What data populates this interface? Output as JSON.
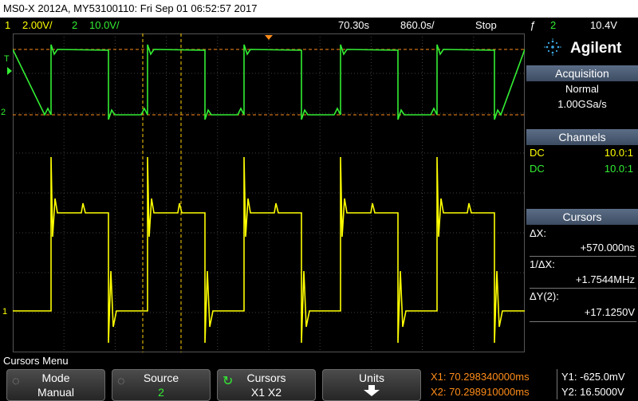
{
  "title": "MS0-X 2012A, MY53100110: Fri Sep 01 06:52:57 2017",
  "status": {
    "ch1_num": "1",
    "ch1_scale": "2.00V/",
    "ch2_num": "2",
    "ch2_scale": "10.0V/",
    "time_delay": "70.30s",
    "time_scale": "860.0s/",
    "run_state": "Stop",
    "trigger_icon": "trigger-edge-icon",
    "trigger_glyph": "ƒ",
    "trigger_source": "2",
    "trigger_level": "10.4V"
  },
  "brand": {
    "name": "Agilent"
  },
  "acquisition": {
    "header": "Acquisition",
    "mode": "Normal",
    "rate": "1.00GSa/s"
  },
  "channels": {
    "header": "Channels",
    "rows": [
      {
        "coupling": "DC",
        "probe": "10.0:1",
        "color": "#ffff00"
      },
      {
        "coupling": "DC",
        "probe": "10.0:1",
        "color": "#33ee33"
      }
    ]
  },
  "cursors_panel": {
    "header": "Cursors",
    "dx_label": "ΔX:",
    "dx_value": "+570.000ns",
    "inv_dx_label": "1/ΔX:",
    "inv_dx_value": "+1.7544MHz",
    "dy_label": "ΔY(2):",
    "dy_value": "+17.1250V"
  },
  "markers": {
    "trigger": "T",
    "ch2": "2",
    "ch1": "1"
  },
  "menu": {
    "title": "Cursors Menu",
    "softkeys": [
      {
        "line1": "Mode",
        "line2": "Manual"
      },
      {
        "line1": "Source",
        "line2": "2"
      },
      {
        "line1": "Cursors",
        "line2": "X1 X2",
        "icon": "knob-icon"
      },
      {
        "line1": "Units",
        "line2": "",
        "icon": "down-arrow-icon"
      }
    ]
  },
  "readout": {
    "x1": "X1: 70.298340000ms",
    "x2": "X2: 70.298910000ms",
    "y1": "Y1: -625.0mV",
    "y2": "Y2: 16.5000V"
  },
  "colors": {
    "ch1": "#ffff00",
    "ch2": "#33ee33",
    "cursor": "#ff8c1a",
    "x_cursor": "#ffd200",
    "accent_blue": "#5b6d86"
  }
}
